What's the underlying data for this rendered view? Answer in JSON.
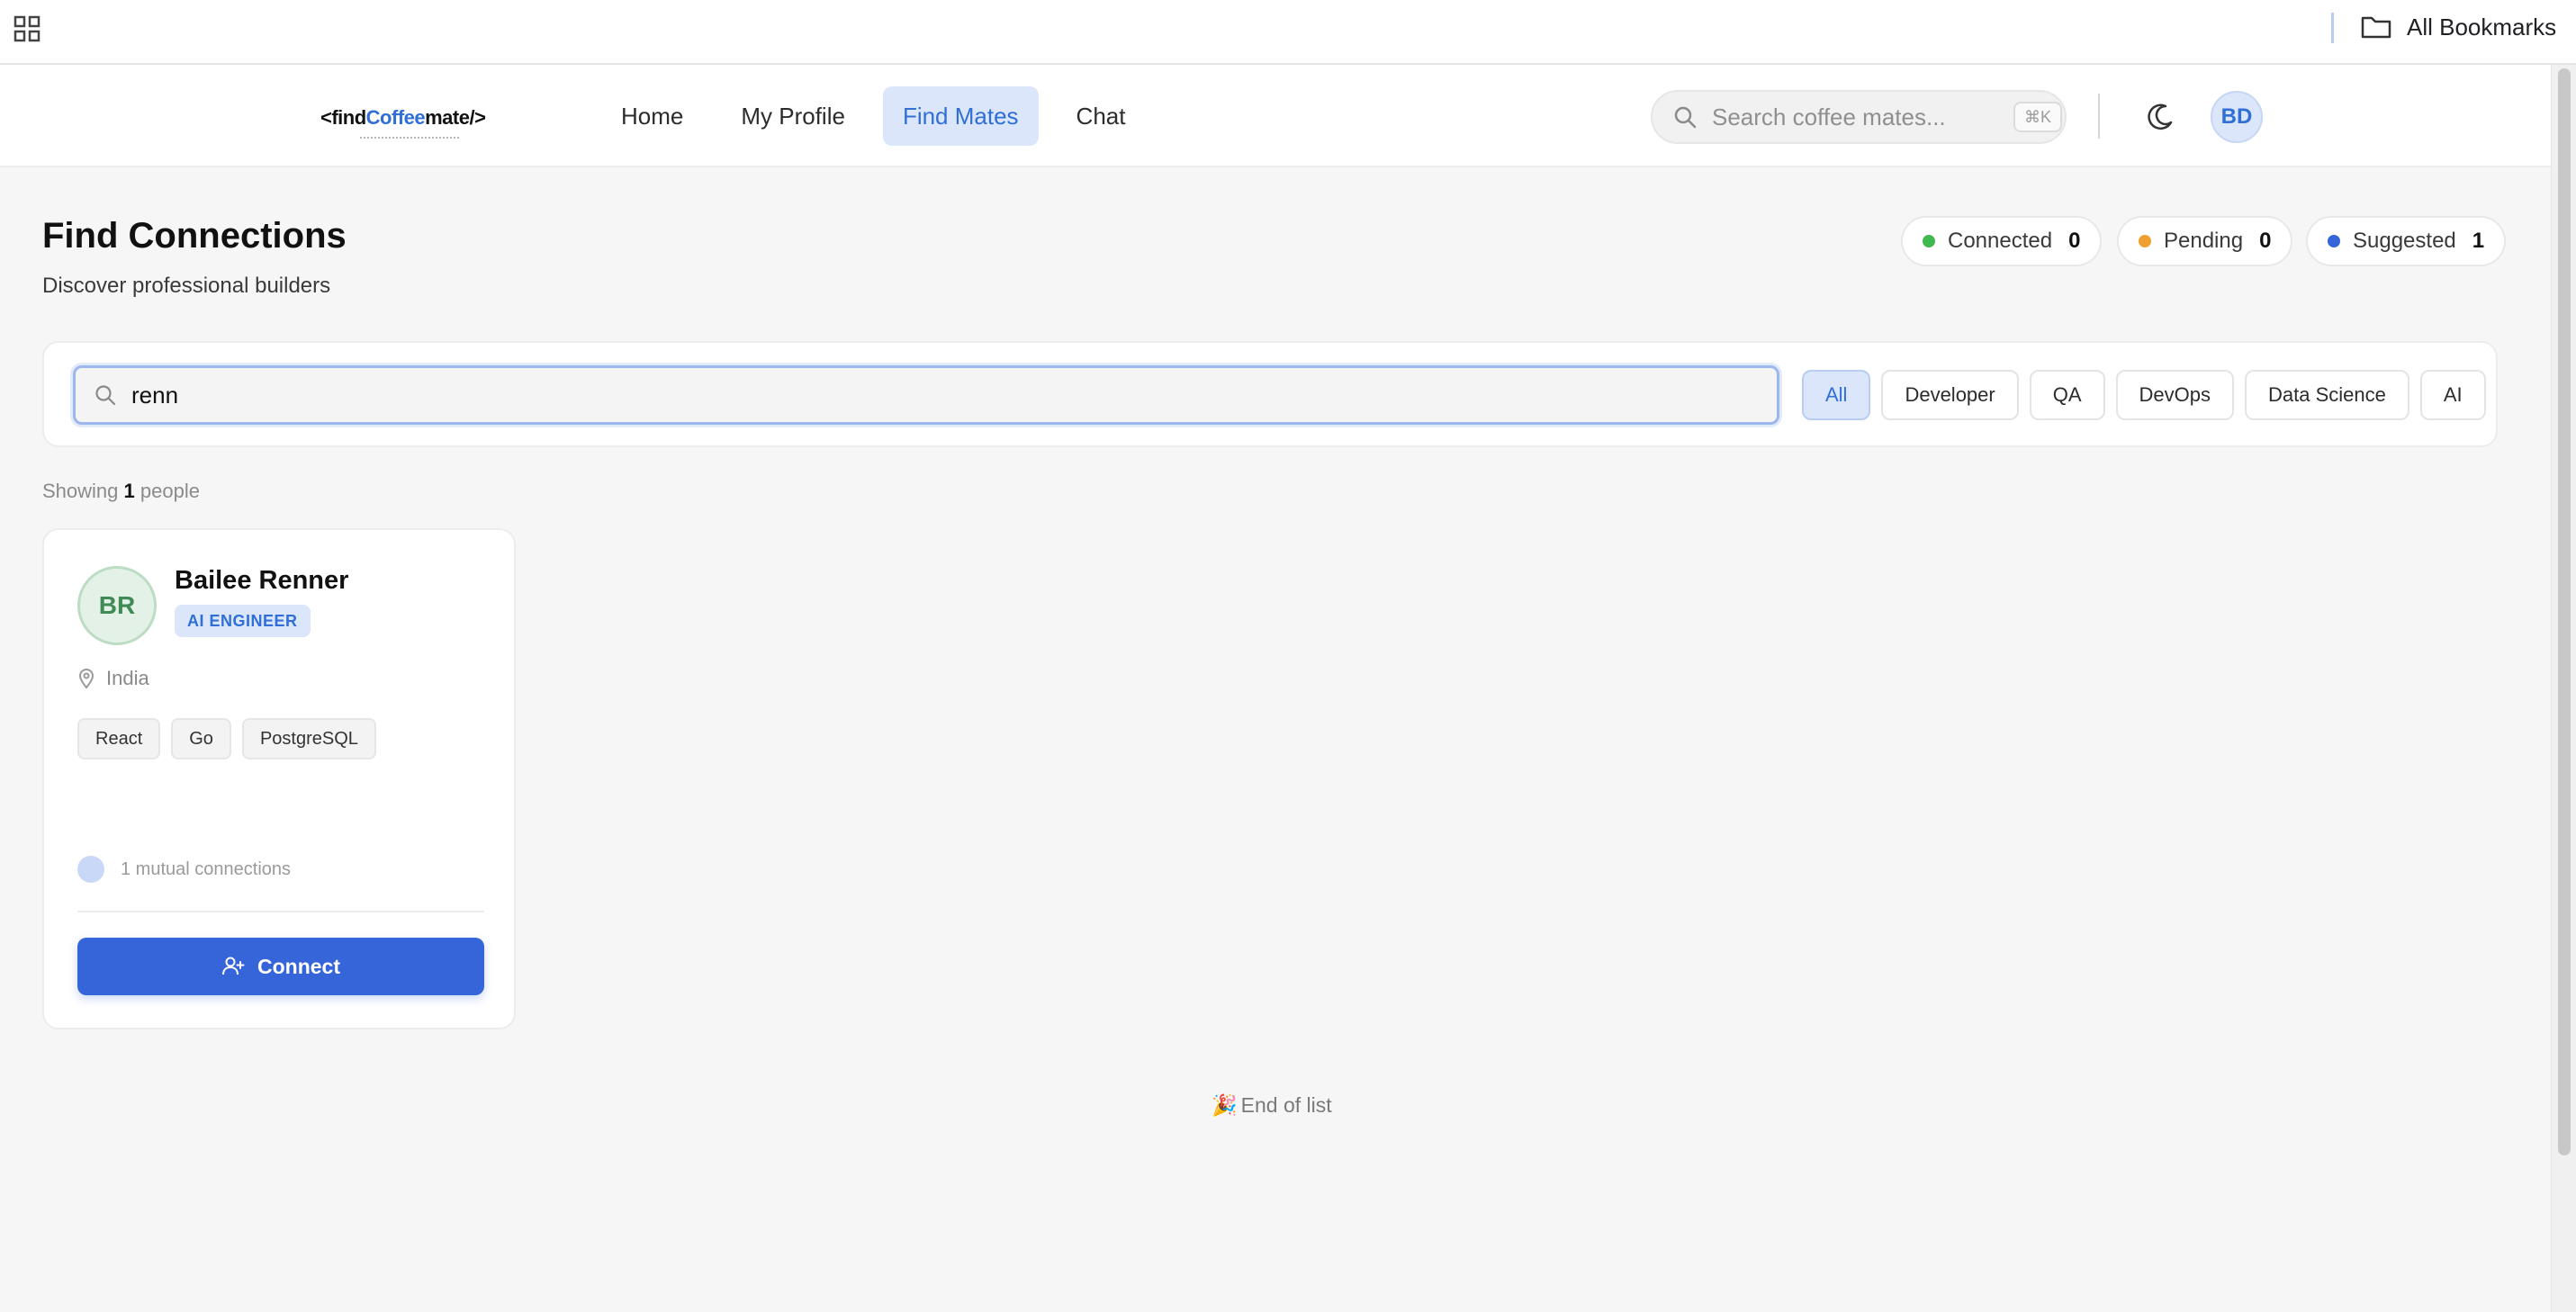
{
  "browser": {
    "bookmarks_label": "All Bookmarks",
    "apps_icon": "apps-grid-icon",
    "folder_icon": "folder-icon"
  },
  "header": {
    "logo": {
      "prefix": "<find",
      "accent": "Coffee",
      "suffix": "mate/>"
    },
    "nav": [
      {
        "label": "Home",
        "active": false
      },
      {
        "label": "My Profile",
        "active": false
      },
      {
        "label": "Find Mates",
        "active": true
      },
      {
        "label": "Chat",
        "active": false
      }
    ],
    "search": {
      "placeholder": "Search coffee mates...",
      "shortcut": "⌘K"
    },
    "theme_icon": "moon-icon",
    "user_initials": "BD"
  },
  "page": {
    "title": "Find Connections",
    "subtitle": "Discover professional builders",
    "stats": [
      {
        "label": "Connected",
        "value": "0",
        "color": "#3fb950"
      },
      {
        "label": "Pending",
        "value": "0",
        "color": "#f0a030"
      },
      {
        "label": "Suggested",
        "value": "1",
        "color": "#3565d9"
      }
    ]
  },
  "filters": {
    "search_value": "renn",
    "categories": [
      {
        "label": "All",
        "active": true
      },
      {
        "label": "Developer",
        "active": false
      },
      {
        "label": "QA",
        "active": false
      },
      {
        "label": "DevOps",
        "active": false
      },
      {
        "label": "Data Science",
        "active": false
      },
      {
        "label": "AI",
        "active": false
      }
    ]
  },
  "results": {
    "showing_prefix": "Showing",
    "count": "1",
    "showing_suffix": "people",
    "end_emoji": "🎉",
    "end_text": "End of list"
  },
  "people": [
    {
      "initials": "BR",
      "name": "Bailee Renner",
      "role": "AI ENGINEER",
      "location": "India",
      "skills": [
        "React",
        "Go",
        "PostgreSQL"
      ],
      "mutual": "1 mutual connections",
      "action": "Connect"
    }
  ],
  "colors": {
    "accent": "#2f6fd6",
    "primary_button": "#3565d9",
    "background": "#f6f6f6"
  }
}
